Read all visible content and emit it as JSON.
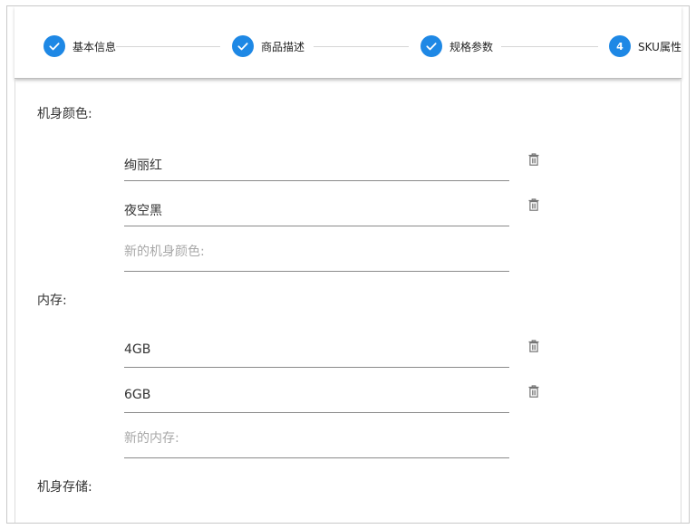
{
  "stepper": {
    "steps": [
      {
        "label": "基本信息",
        "state": "completed",
        "number": "1"
      },
      {
        "label": "商品描述",
        "state": "completed",
        "number": "2"
      },
      {
        "label": "规格参数",
        "state": "completed",
        "number": "3"
      },
      {
        "label": "SKU属性",
        "state": "active",
        "number": "4"
      }
    ]
  },
  "groups": [
    {
      "label": "机身颜色:",
      "options": [
        "绚丽红",
        "夜空黑"
      ],
      "new_placeholder": "新的机身颜色:"
    },
    {
      "label": "内存:",
      "options": [
        "4GB",
        "6GB"
      ],
      "new_placeholder": "新的内存:"
    },
    {
      "label": "机身存储:",
      "options": [],
      "new_placeholder": ""
    }
  ],
  "colors": {
    "accent": "#1e88e5",
    "icon": "#757575",
    "placeholder": "#a8a8a8"
  },
  "icons": {
    "completed_step": "check-icon",
    "delete_option": "trash-icon"
  }
}
